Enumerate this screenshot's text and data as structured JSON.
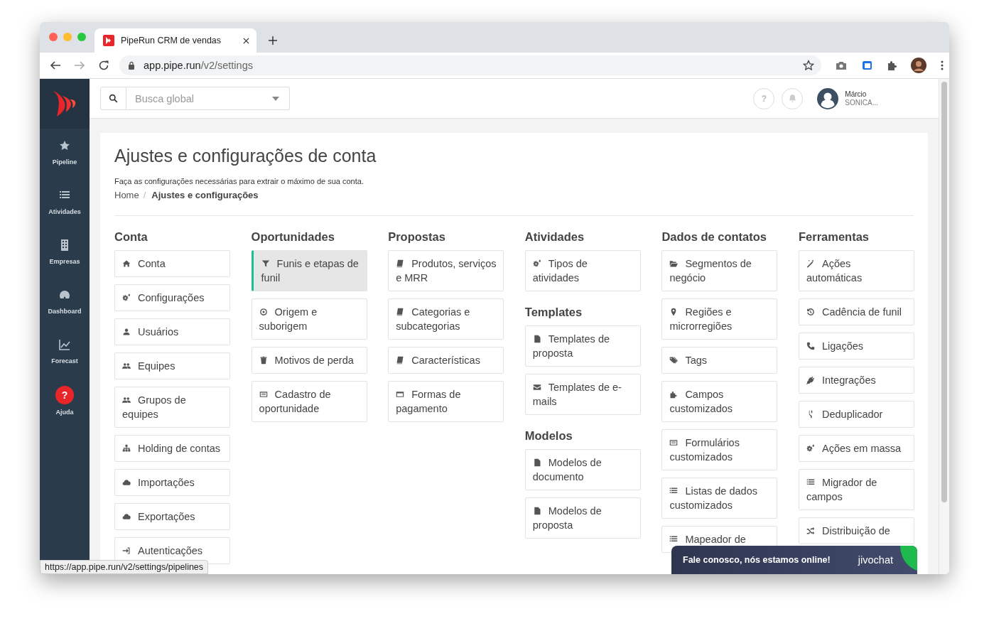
{
  "browser": {
    "tab_title": "PipeRun CRM de vendas",
    "url_host": "app.pipe.run",
    "url_path": "/v2/settings",
    "status_url": "https://app.pipe.run/v2/settings/pipelines"
  },
  "sidebar": {
    "items": [
      {
        "label": "Pipeline",
        "kind": "star"
      },
      {
        "label": "Atividades",
        "kind": "list"
      },
      {
        "label": "Empresas",
        "kind": "building"
      },
      {
        "label": "Dashboard",
        "kind": "gauge"
      },
      {
        "label": "Forecast",
        "kind": "chart"
      },
      {
        "label": "Ajuda",
        "kind": "help",
        "badge": "?"
      }
    ]
  },
  "topbar": {
    "search": {
      "placeholder": "Busca global"
    },
    "help": "?",
    "user": {
      "name": "Márcio",
      "company": "SONICA..."
    }
  },
  "page": {
    "title": "Ajustes e configurações de conta",
    "subtitle": "Faça as configurações necessárias para extrair o máximo de sua conta.",
    "breadcrumb": [
      "Home",
      "Ajustes e configurações"
    ],
    "breadcrumb_separator": "/"
  },
  "columns": [
    {
      "sections": [
        {
          "title": "Conta",
          "items": [
            {
              "label": "Conta",
              "selected": false
            },
            {
              "label": "Configurações",
              "selected": false
            },
            {
              "label": "Usuários",
              "selected": false
            },
            {
              "label": "Equipes",
              "selected": false
            },
            {
              "label": "Grupos de equipes",
              "selected": false
            },
            {
              "label": "Holding de contas",
              "selected": false
            },
            {
              "label": "Importações",
              "selected": false
            },
            {
              "label": "Exportações",
              "selected": false
            },
            {
              "label": "Autenticações",
              "selected": false
            }
          ]
        }
      ]
    },
    {
      "sections": [
        {
          "title": "Oportunidades",
          "items": [
            {
              "label": "Funis e etapas de funil",
              "selected": true
            },
            {
              "label": "Origem e suborigem",
              "selected": false
            },
            {
              "label": "Motivos de perda",
              "selected": false
            },
            {
              "label": "Cadastro de oportunidade",
              "selected": false
            }
          ]
        }
      ]
    },
    {
      "sections": [
        {
          "title": "Propostas",
          "items": [
            {
              "label": "Produtos, serviços e MRR",
              "selected": false
            },
            {
              "label": "Categorias e subcategorias",
              "selected": false
            },
            {
              "label": "Características",
              "selected": false
            },
            {
              "label": "Formas de pagamento",
              "selected": false
            }
          ]
        }
      ]
    },
    {
      "sections": [
        {
          "title": "Atividades",
          "items": [
            {
              "label": "Tipos de atividades",
              "selected": false
            }
          ]
        },
        {
          "title": "Templates",
          "items": [
            {
              "label": "Templates de proposta",
              "selected": false
            },
            {
              "label": "Templates de e-mails",
              "selected": false
            }
          ]
        },
        {
          "title": "Modelos",
          "items": [
            {
              "label": "Modelos de documento",
              "selected": false
            },
            {
              "label": "Modelos de proposta",
              "selected": false
            }
          ]
        }
      ]
    },
    {
      "sections": [
        {
          "title": "Dados de contatos",
          "items": [
            {
              "label": "Segmentos de negócio",
              "selected": false
            },
            {
              "label": "Regiões e microrregiões",
              "selected": false
            },
            {
              "label": "Tags",
              "selected": false
            },
            {
              "label": "Campos customizados",
              "selected": false
            },
            {
              "label": "Formulários customizados",
              "selected": false
            },
            {
              "label": "Listas de dados customizados",
              "selected": false
            },
            {
              "label": "Mapeador de",
              "selected": false
            }
          ]
        }
      ]
    },
    {
      "sections": [
        {
          "title": "Ferramentas",
          "items": [
            {
              "label": "Ações automáticas",
              "selected": false
            },
            {
              "label": "Cadência de funil",
              "selected": false
            },
            {
              "label": "Ligações",
              "selected": false
            },
            {
              "label": "Integrações",
              "selected": false
            },
            {
              "label": "Deduplicador",
              "selected": false
            },
            {
              "label": "Ações em massa",
              "selected": false
            },
            {
              "label": "Migrador de campos",
              "selected": false
            },
            {
              "label": "Distribuição de",
              "selected": false
            }
          ]
        }
      ]
    }
  ],
  "chat": {
    "message": "Fale conosco, nós estamos online!",
    "brand": "jivochat"
  }
}
